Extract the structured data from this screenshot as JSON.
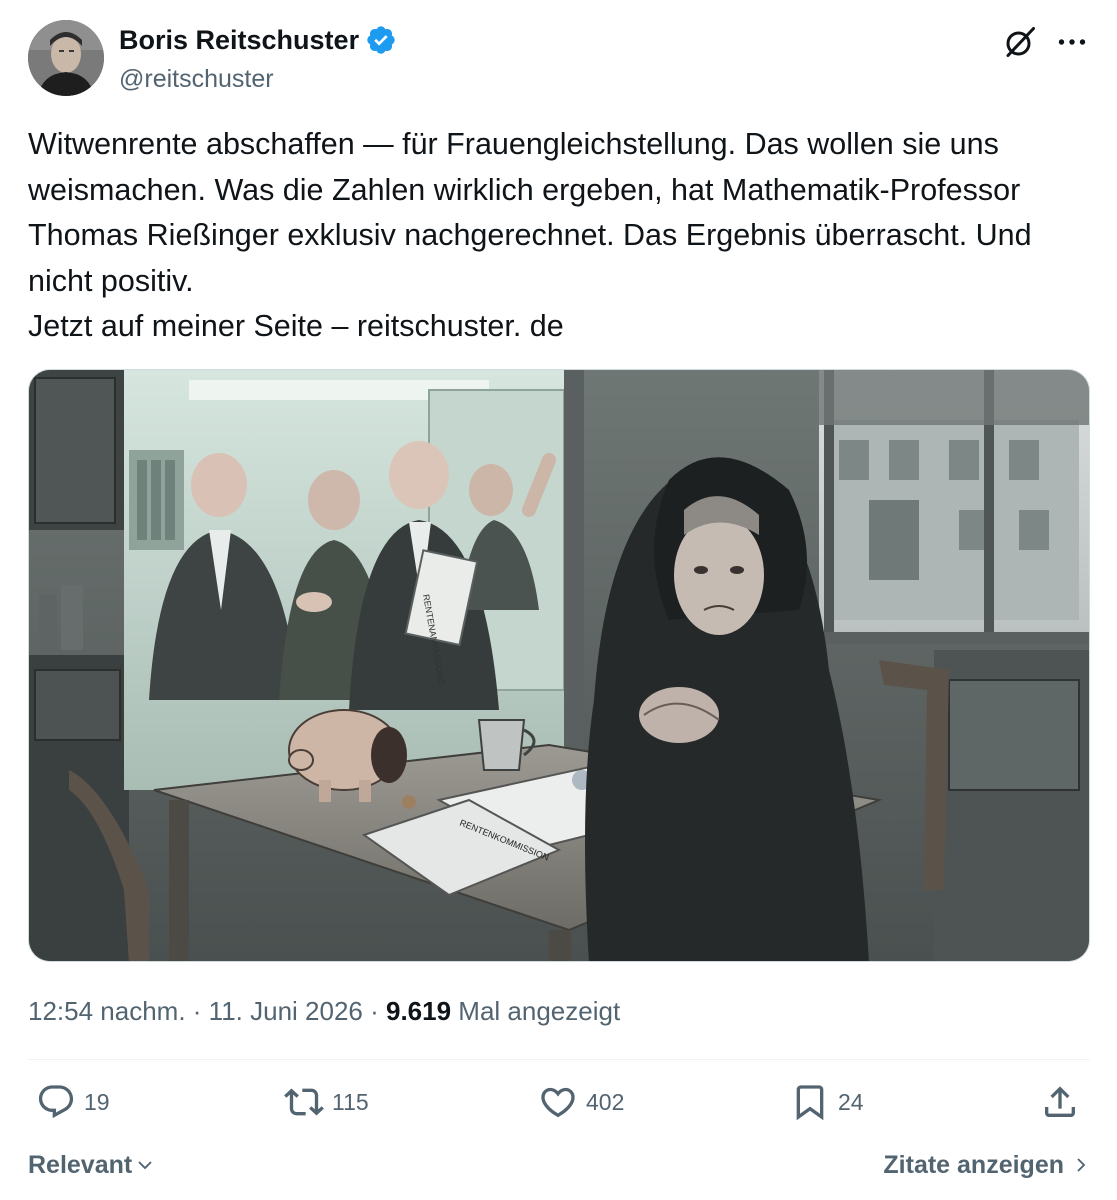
{
  "author": {
    "display_name": "Boris Reitschuster",
    "handle": "@reitschuster",
    "verified_color": "#1d9bf0"
  },
  "icons": {
    "verified": "verified-badge-icon",
    "grok": "grok-icon",
    "more": "more-dots-icon",
    "reply": "reply-bubble-icon",
    "retweet": "retweet-icon",
    "like": "heart-icon",
    "bookmark": "bookmark-icon",
    "share": "share-upload-icon"
  },
  "tweet": {
    "text": "Witwenrente abschaffen — für Frauengleichstellung. Das wollen sie uns weismachen. Was die Zahlen wirklich ergeben, hat Mathematik-Professor Thomas Rießinger exklusiv nachgerechnet. Das Ergebnis überrascht. Und nicht positiv.\nJetzt auf meiner Seite – reitschuster. de"
  },
  "media": {
    "folder_label": "RENTENANPASSUNG",
    "letter_label": "RENTENKOMMISSION"
  },
  "meta": {
    "time": "12:54 nachm.",
    "separator": " · ",
    "date": "11. Juni 2026",
    "views_count": "9.619",
    "views_label": "Mal angezeigt"
  },
  "actions": {
    "replies": "19",
    "retweets": "115",
    "likes": "402",
    "bookmarks": "24"
  },
  "footer": {
    "sort_label": "Relevant",
    "quotes_label": "Zitate anzeigen"
  },
  "colors": {
    "secondary_text": "#536471",
    "primary_text": "#0f1419",
    "accent": "#1d9bf0",
    "divider": "#eff3f4"
  }
}
